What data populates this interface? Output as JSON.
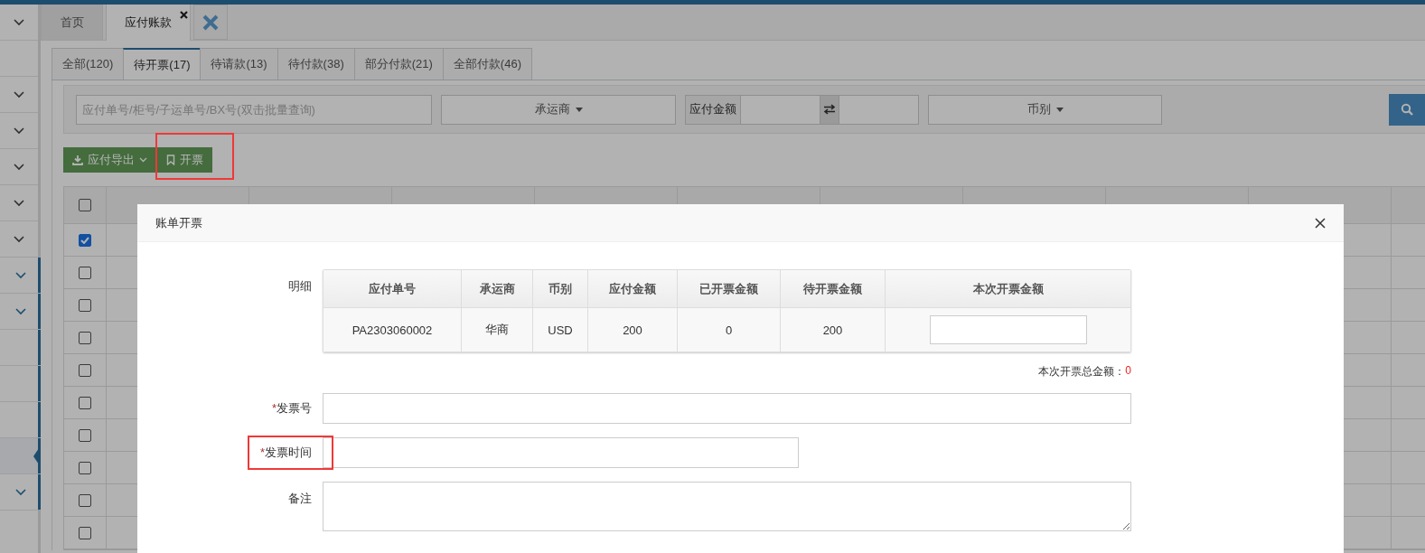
{
  "sidebar": {
    "items": [
      {
        "expandable": true,
        "selected": false,
        "active_group": false
      },
      {
        "expandable": false,
        "selected": false,
        "active_group": false
      },
      {
        "expandable": true,
        "selected": false,
        "active_group": false
      },
      {
        "expandable": true,
        "selected": false,
        "active_group": false
      },
      {
        "expandable": true,
        "selected": false,
        "active_group": false
      },
      {
        "expandable": true,
        "selected": false,
        "active_group": false
      },
      {
        "expandable": true,
        "selected": false,
        "active_group": false
      },
      {
        "expandable": true,
        "selected": false,
        "active_group": true
      },
      {
        "expandable": true,
        "selected": false,
        "active_group": true
      },
      {
        "expandable": false,
        "selected": false,
        "active_group": true
      },
      {
        "expandable": false,
        "selected": false,
        "active_group": true
      },
      {
        "expandable": false,
        "selected": false,
        "active_group": true
      },
      {
        "expandable": false,
        "selected": true,
        "active_group": true
      },
      {
        "expandable": true,
        "selected": false,
        "active_group": true
      }
    ]
  },
  "page_tabs": [
    {
      "label": "首页",
      "selected": false,
      "closable": false
    },
    {
      "label": "应付账款",
      "selected": true,
      "closable": true
    }
  ],
  "status_tabs": [
    {
      "label": "全部(120)",
      "selected": false
    },
    {
      "label": "待开票(17)",
      "selected": true
    },
    {
      "label": "待请款(13)",
      "selected": false
    },
    {
      "label": "待付款(38)",
      "selected": false
    },
    {
      "label": "部分付款(21)",
      "selected": false
    },
    {
      "label": "全部付款(46)",
      "selected": false
    }
  ],
  "filters": {
    "search": {
      "placeholder": "应付单号/柜号/子运单号/BX号(双击批量查询)"
    },
    "carrier": "承运商",
    "amount_label": "应付金额",
    "currency": "币别"
  },
  "actions": [
    {
      "kind": "export",
      "label": "应付导出",
      "highlighted": false
    },
    {
      "kind": "invoice",
      "label": "开票",
      "highlighted": true
    }
  ],
  "table": {
    "header_checked": false,
    "rows": [
      {
        "checked": true
      },
      {
        "checked": false
      },
      {
        "checked": false
      },
      {
        "checked": false
      },
      {
        "checked": false
      },
      {
        "checked": false
      },
      {
        "checked": false
      },
      {
        "checked": false
      },
      {
        "checked": false
      },
      {
        "checked": false
      }
    ]
  },
  "dialog": {
    "title": "账单开票",
    "detail_label": "明细",
    "detail_columns": [
      "应付单号",
      "承运商",
      "币别",
      "应付金额",
      "已开票金额",
      "待开票金额",
      "本次开票金额"
    ],
    "detail_rows": [
      {
        "cells": [
          "PA2303060002",
          "华商",
          "USD",
          "200",
          "0",
          "200"
        ]
      }
    ],
    "total_label": "本次开票总金额：",
    "total_value": "0",
    "fields": [
      {
        "kind": "text",
        "mark": "*",
        "label": "发票号",
        "highlighted": false
      },
      {
        "kind": "short",
        "mark": "*",
        "label": "发票时间",
        "highlighted": true
      },
      {
        "kind": "textarea",
        "label": "备注",
        "highlighted": false
      }
    ]
  }
}
